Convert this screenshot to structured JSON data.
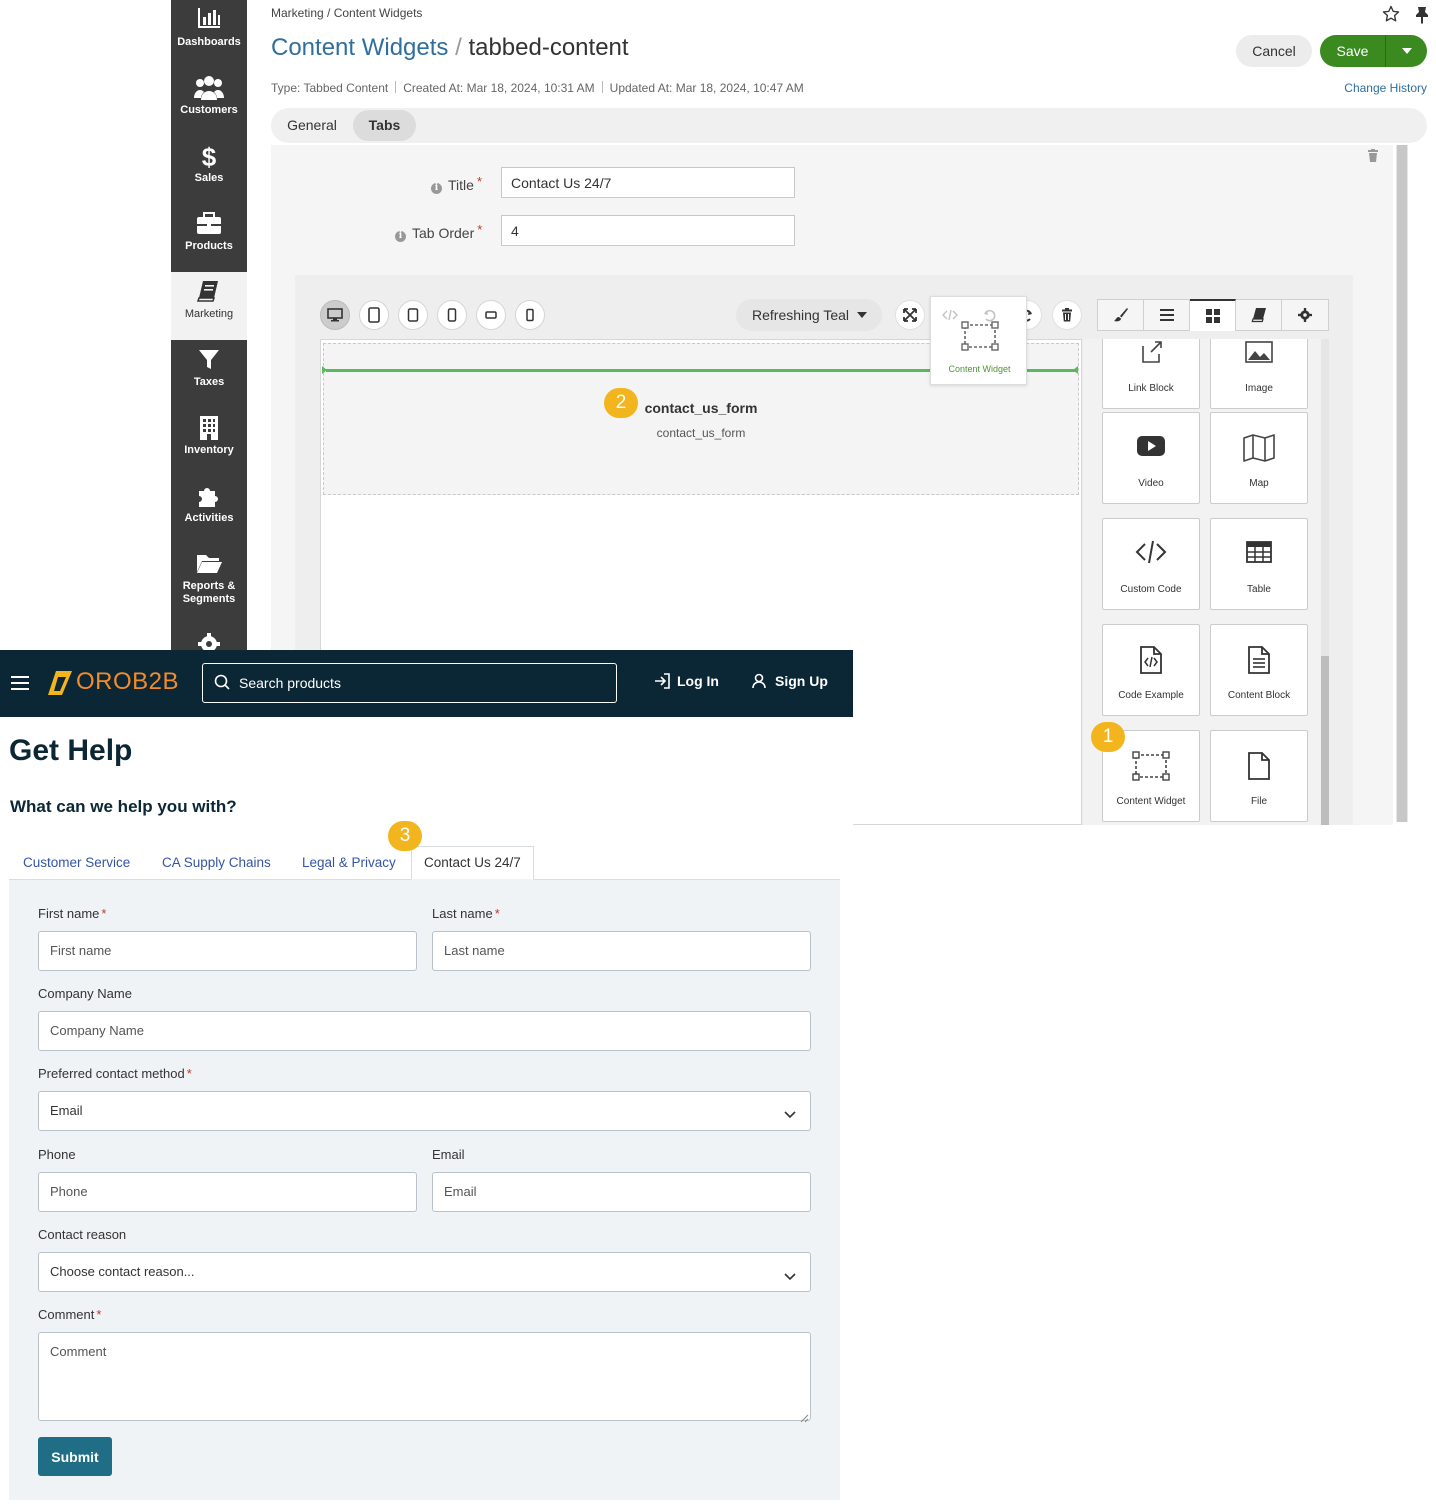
{
  "sidebar": {
    "items": [
      {
        "label": "Dashboards",
        "icon": "bar-chart-icon"
      },
      {
        "label": "Customers",
        "icon": "users-icon"
      },
      {
        "label": "Sales",
        "icon": "dollar-icon"
      },
      {
        "label": "Products",
        "icon": "briefcase-icon"
      },
      {
        "label": "Marketing",
        "icon": "book-icon"
      },
      {
        "label": "Taxes",
        "icon": "filter-icon"
      },
      {
        "label": "Inventory",
        "icon": "building-icon"
      },
      {
        "label": "Activities",
        "icon": "puzzle-icon"
      },
      {
        "label": "Reports &",
        "label2": "Segments",
        "icon": "folder-icon"
      }
    ],
    "active": "Marketing"
  },
  "header": {
    "breadcrumb": "Marketing / Content Widgets",
    "title_link": "Content Widgets",
    "title_sep": "/",
    "title_current": "tabbed-content",
    "meta_type": "Type: Tabbed Content",
    "meta_created": "Created At: Mar 18, 2024, 10:31 AM",
    "meta_updated": "Updated At: Mar 18, 2024, 10:47 AM",
    "cancel_label": "Cancel",
    "save_label": "Save",
    "change_history": "Change History"
  },
  "tabs": {
    "general": "General",
    "tabs": "Tabs",
    "active": "Tabs"
  },
  "form": {
    "title_label": "Title",
    "title_value": "Contact Us 24/7",
    "order_label": "Tab Order",
    "order_value": "4"
  },
  "editor": {
    "theme": "Refreshing Teal",
    "widget_title": "contact_us_form",
    "widget_subtitle": "contact_us_form",
    "drag_ghost_label": "Content Widget",
    "blocks": [
      "Link Block",
      "Image",
      "Video",
      "Map",
      "Custom Code",
      "Table",
      "Code Example",
      "Content Block",
      "Content Widget",
      "File"
    ]
  },
  "badges": {
    "one": "1",
    "two": "2",
    "three": "3"
  },
  "storefront": {
    "logo": "OROB2B",
    "search_placeholder": "Search products",
    "login": "Log In",
    "signup": "Sign Up",
    "heading": "Get Help",
    "subheading": "What can we help you with?",
    "tabs": [
      "Customer Service",
      "CA Supply Chains",
      "Legal & Privacy",
      "Contact Us 24/7"
    ],
    "active_tab": "Contact Us 24/7",
    "fields": {
      "first_name_label": "First name",
      "first_name_placeholder": "First name",
      "last_name_label": "Last name",
      "last_name_placeholder": "Last name",
      "company_label": "Company Name",
      "company_placeholder": "Company Name",
      "contact_method_label": "Preferred contact method",
      "contact_method_value": "Email",
      "phone_label": "Phone",
      "phone_placeholder": "Phone",
      "email_label": "Email",
      "email_placeholder": "Email",
      "reason_label": "Contact reason",
      "reason_value": "Choose contact reason...",
      "comment_label": "Comment",
      "comment_placeholder": "Comment",
      "required_mark": "*"
    },
    "submit": "Submit"
  },
  "colors": {
    "sidebar_bg": "#3c3c3c",
    "link_blue": "#2f6f9f",
    "save_green": "#3a8a1f",
    "badge_yellow": "#f2b51d",
    "storefront_navy": "#0b2634",
    "storefront_orange": "#f28b2c",
    "submit_teal": "#1f6e85"
  }
}
